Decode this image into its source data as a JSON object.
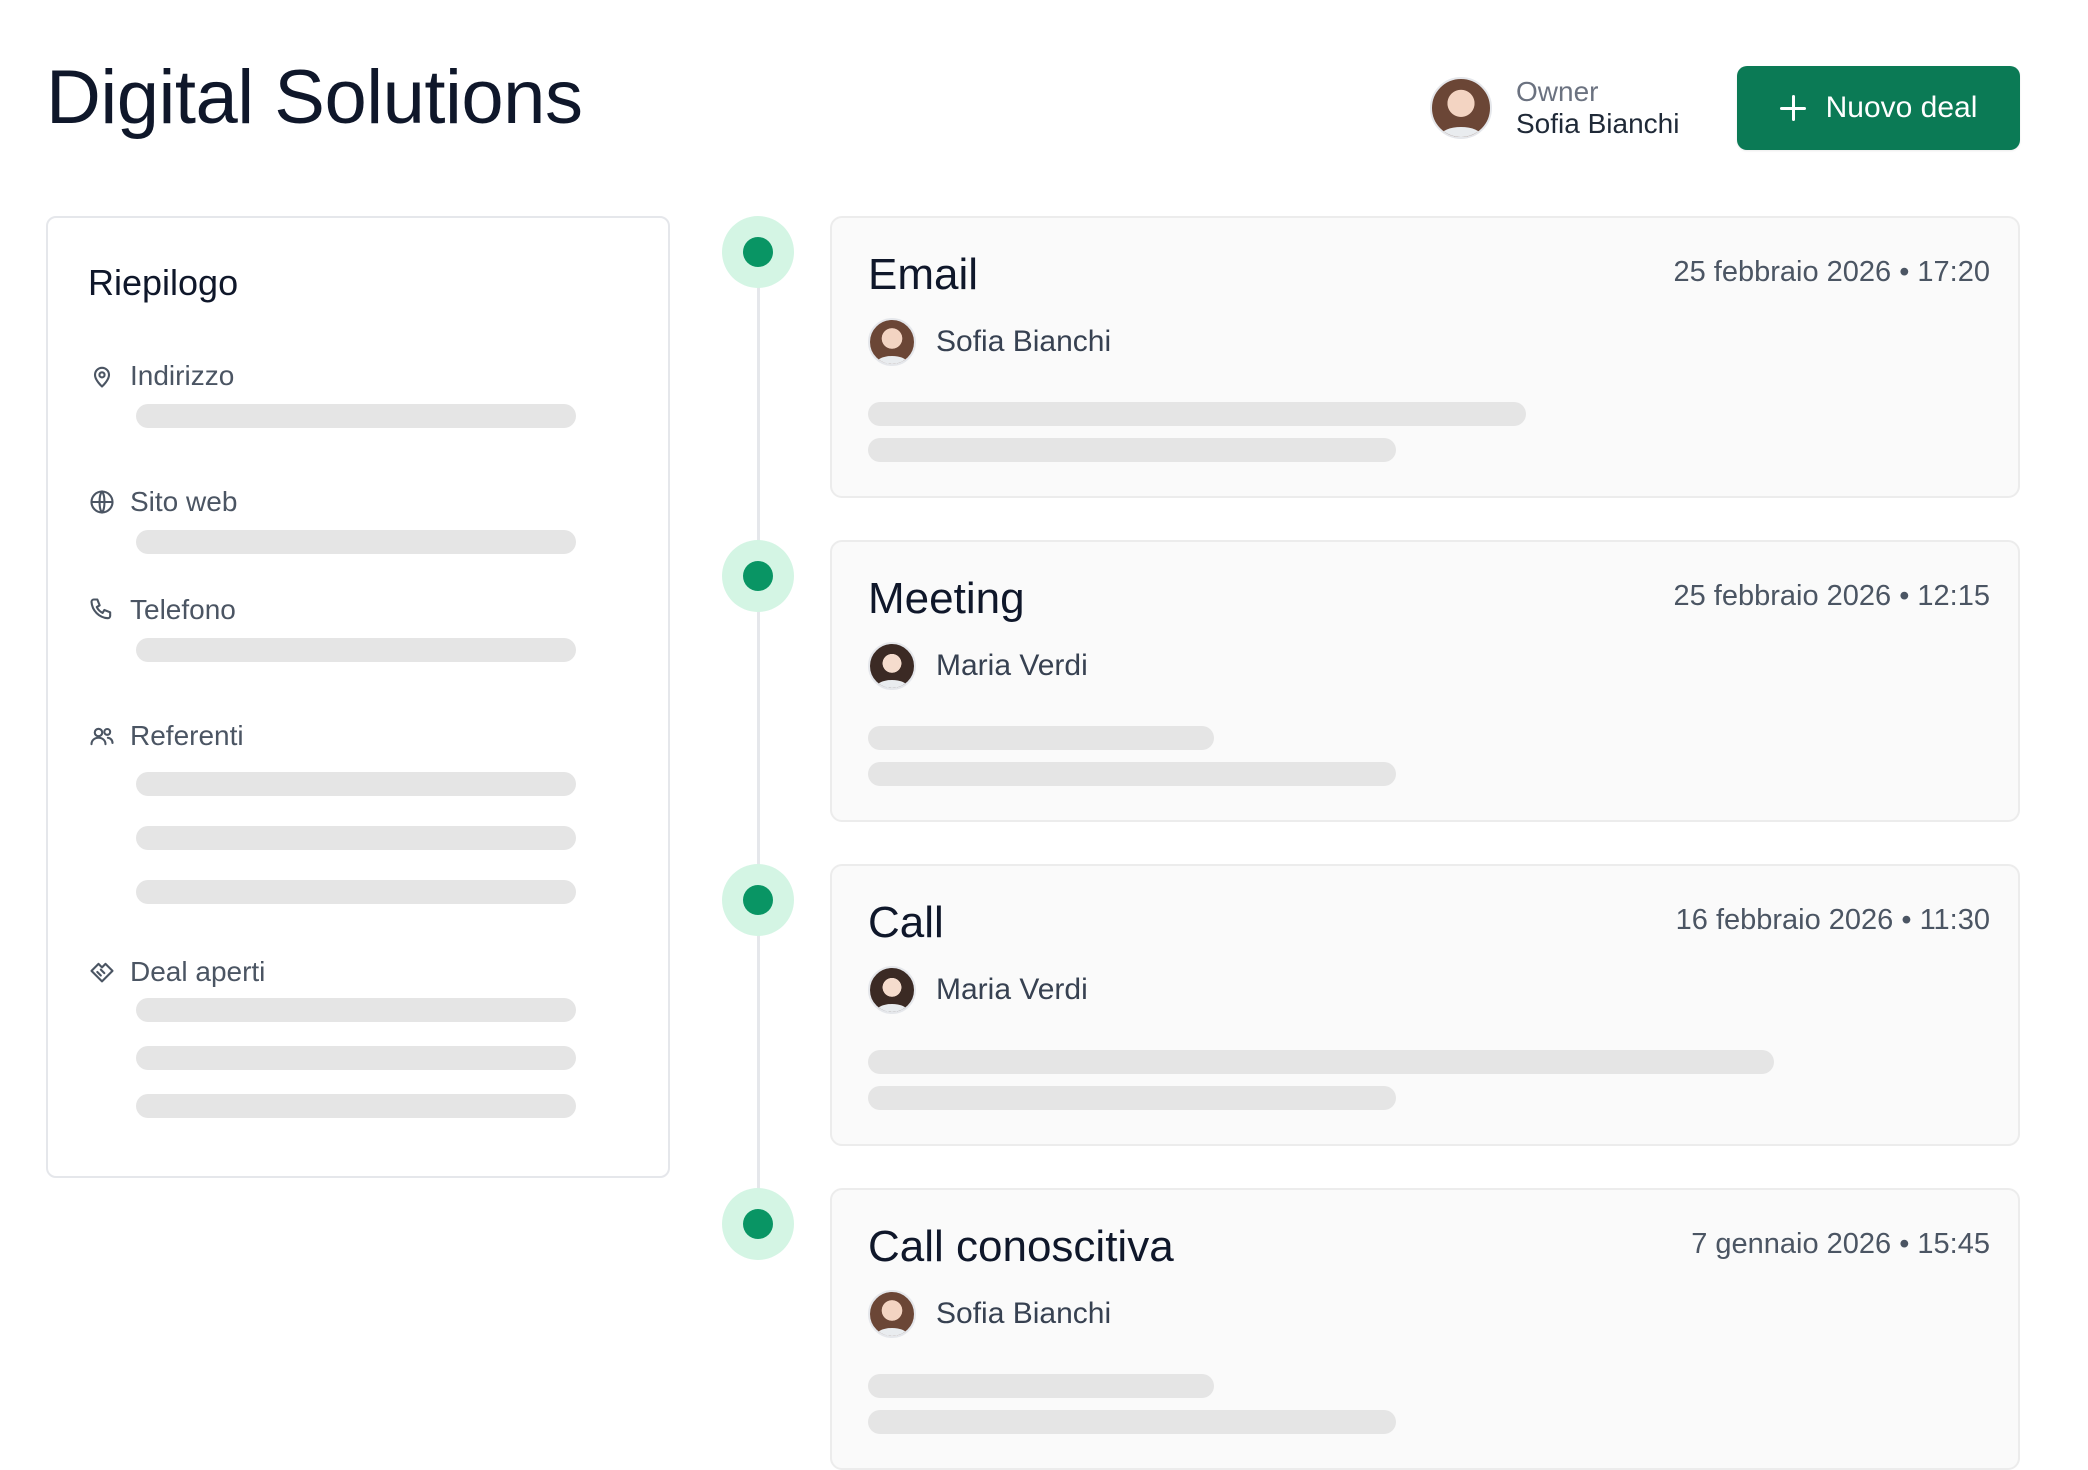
{
  "header": {
    "title": "Digital Solutions",
    "owner_label": "Owner",
    "owner_name": "Sofia Bianchi",
    "new_deal_label": "Nuovo deal"
  },
  "summary": {
    "title": "Riepilogo",
    "fields": [
      {
        "label": "Indirizzo",
        "icon": "map-pin-icon"
      },
      {
        "label": "Sito web",
        "icon": "globe-icon"
      },
      {
        "label": "Telefono",
        "icon": "phone-icon"
      },
      {
        "label": "Referenti",
        "icon": "users-icon"
      },
      {
        "label": "Deal aperti",
        "icon": "handshake-icon"
      }
    ]
  },
  "activities": [
    {
      "type": "Email",
      "date": "25 febbraio 2026 • 17:20",
      "author": "Sofia Bianchi"
    },
    {
      "type": "Meeting",
      "date": "25 febbraio 2026 • 12:15",
      "author": "Maria Verdi"
    },
    {
      "type": "Call",
      "date": "16 febbraio 2026 • 11:30",
      "author": "Maria Verdi"
    },
    {
      "type": "Call conoscitiva",
      "date": "7 gennaio 2026 • 15:45",
      "author": "Sofia Bianchi"
    }
  ],
  "colors": {
    "accent": "#0b7a55",
    "timeline_dot": "#099564",
    "timeline_dot_halo": "#d4f5e4",
    "skeleton": "#e5e5e5"
  }
}
